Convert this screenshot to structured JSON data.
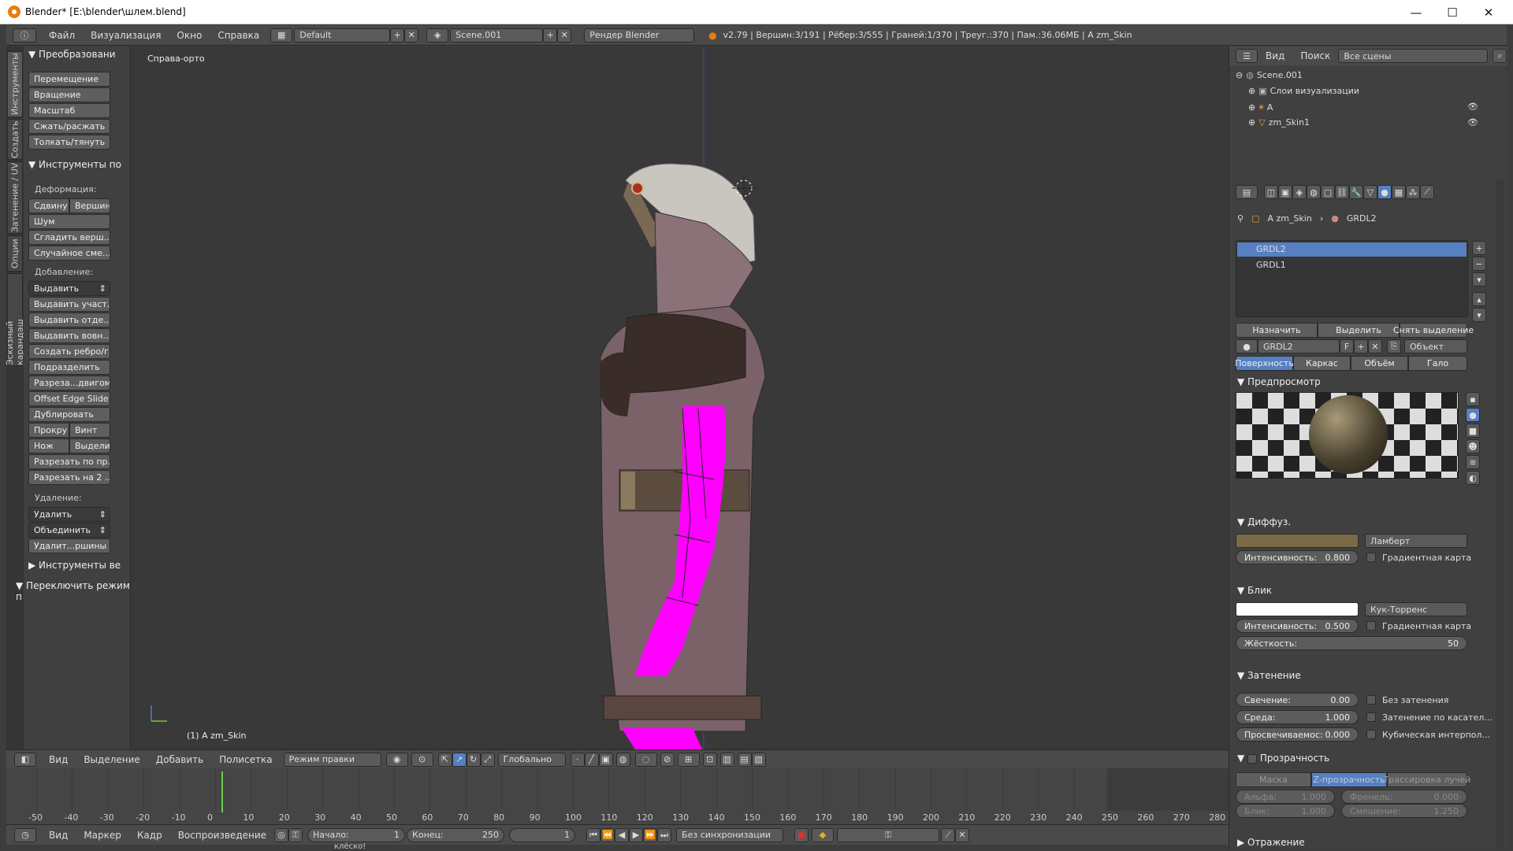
{
  "window": {
    "title": "Blender* [E:\\blender\\шлем.blend]",
    "minimize": "—",
    "maximize": "☐",
    "close": "✕"
  },
  "infobar": {
    "menus": [
      "Файл",
      "Визуализация",
      "Окно",
      "Справка"
    ],
    "layout": "Default",
    "scene": "Scene.001",
    "engine": "Рендер Blender",
    "stats": "v2.79 | Вершин:3/191 | Рёбер:3/555 | Граней:1/370 | Треуг.:370 | Пам.:36.06МБ | A zm_Skin"
  },
  "vtabs": [
    "Инструменты",
    "Создать",
    "Затенение / UV",
    "Опции",
    "Эскизный карандаш"
  ],
  "toolshelf": {
    "transform_hdr": "Преобразовани",
    "transform": [
      "Перемещение",
      "Вращение",
      "Масштаб",
      "Сжать/расжать",
      "Толкать/тянуть"
    ],
    "mesh_hdr": "Инструменты по",
    "deform_lbl": "Деформация:",
    "slide": "Сдвину",
    "vert": "Вершин",
    "noise": "Шум",
    "smooth": "Сгладить верш...",
    "random": "Случайное сме...",
    "add_lbl": "Добавление:",
    "extrude": "Выдавить",
    "extrude_region": "Выдавить участ...",
    "extrude_indiv": "Выдавить отде...",
    "extrude_in": "Выдавить вовн...",
    "make_edge": "Создать ребро/г...",
    "subdivide": "Подразделить",
    "loopcut": "Разреза...двигом",
    "offset": "Offset Edge Slide",
    "duplicate": "Дублировать",
    "spin": "Прокру",
    "screw": "Винт",
    "knife": "Нож",
    "select": "Выдели",
    "bisect": "Разрезать по пр...",
    "split": "Разрезать на 2 ...",
    "del_lbl": "Удаление:",
    "delete": "Удалить",
    "merge": "Объединить",
    "remove_doubles": "Удалит...ршины",
    "history_hdr": "Инструменты ве",
    "toggle_hdr": "Переключить режим п"
  },
  "viewport": {
    "view_label": "Справа-орто",
    "object_label": "(1) A zm_Skin"
  },
  "vp_header": {
    "menus": [
      "Вид",
      "Выделение",
      "Добавить",
      "Полисетка"
    ],
    "mode": "Режим правки",
    "orientation": "Глобально"
  },
  "timeline": {
    "ticks": [
      "-50",
      "-40",
      "-30",
      "-20",
      "-10",
      "0",
      "10",
      "20",
      "30",
      "40",
      "50",
      "60",
      "70",
      "80",
      "90",
      "100",
      "110",
      "120",
      "130",
      "140",
      "150",
      "160",
      "170",
      "180",
      "190",
      "200",
      "210",
      "220",
      "230",
      "240",
      "250",
      "260",
      "270",
      "280"
    ],
    "current_frame": 1,
    "menus": [
      "Вид",
      "Маркер",
      "Кадр",
      "Воспроизведение"
    ],
    "start_lbl": "Начало:",
    "start": "1",
    "end_lbl": "Конец:",
    "end": "250",
    "frame": "1",
    "sync": "Без синхронизации",
    "bottom_text": "клёско!"
  },
  "outliner": {
    "menus": [
      "Вид",
      "Поиск"
    ],
    "filter": "Все сцены",
    "items": [
      "Scene.001",
      "Слои визуализации",
      "A",
      "zm_Skin1"
    ]
  },
  "props": {
    "breadcrumb_obj": "A zm_Skin",
    "breadcrumb_mat": "GRDL2",
    "slots": [
      "GRDL2",
      "GRDL1"
    ],
    "assign": "Назначить",
    "select": "Выделить",
    "deselect": "Снять выделение",
    "mat_name": "GRDL2",
    "mat_f": "F",
    "link": "Объект",
    "tabs": [
      "Поверхность",
      "Каркас",
      "Объём",
      "Гало"
    ],
    "preview_hdr": "Предпросмотр",
    "diffuse_hdr": "Диффуз.",
    "diffuse_shader": "Ламберт",
    "intensity_lbl": "Интенсивность:",
    "diff_int": "0.800",
    "ramp": "Градиентная карта",
    "spec_hdr": "Блик",
    "spec_shader": "Кук-Торренс",
    "spec_int": "0.500",
    "hard_lbl": "Жёсткость:",
    "hard": "50",
    "shading_hdr": "Затенение",
    "emit_lbl": "Свечение:",
    "emit": "0.00",
    "ambient_lbl": "Среда:",
    "ambient": "1.000",
    "transl_lbl": "Просвечиваемос:",
    "transl": "0.000",
    "shadeless": "Без затенения",
    "tangent": "Затенение по касател...",
    "cubic": "Кубическая интерпол...",
    "transp_hdr": "Прозрачность",
    "transp_tabs": [
      "Маска",
      "Z-прозрачность",
      "Трассировка лучей"
    ],
    "alpha_lbl": "Альфа:",
    "alpha": "1.000",
    "fresnel_lbl": "Френель:",
    "fresnel": "0.000",
    "specular_lbl": "Блик:",
    "specular": "1.000",
    "blend_lbl": "Смешение:",
    "blend": "1.250",
    "mirror_hdr": "Отражение"
  },
  "colors": {
    "accent": "#5680c2",
    "magenta": "#ff00ff",
    "diffuse": "#7a6a45",
    "bg": "#393939"
  }
}
